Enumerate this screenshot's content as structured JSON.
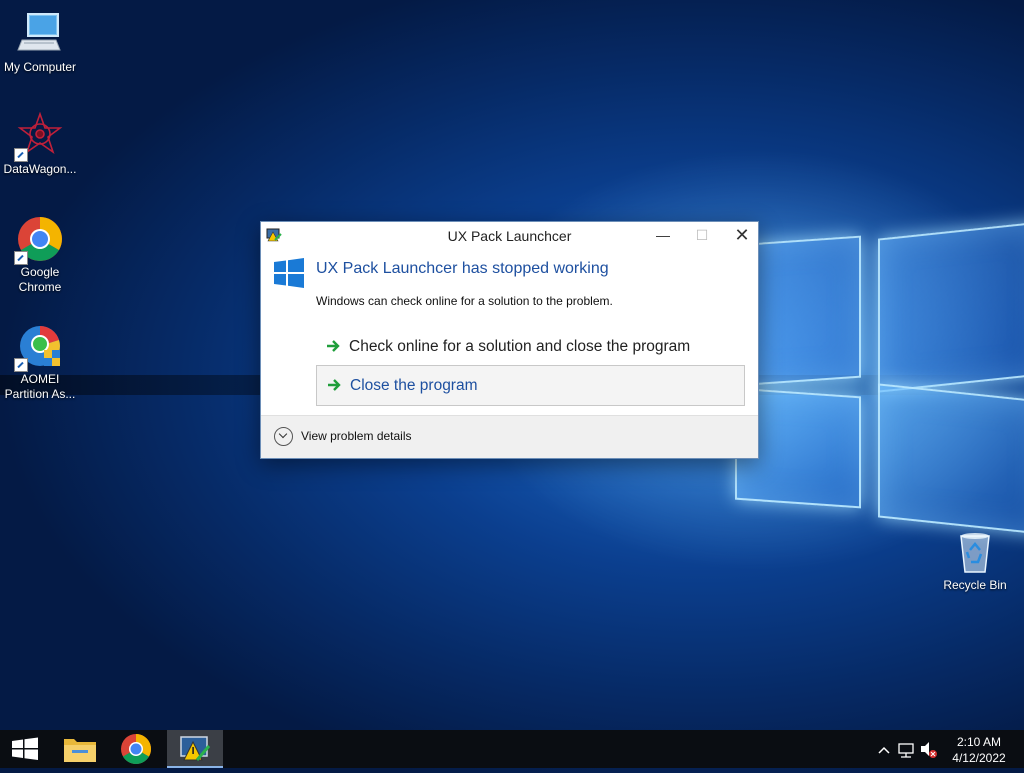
{
  "desktop": {
    "icons": [
      {
        "label_line1": "My Computer",
        "label_line2": ""
      },
      {
        "label_line1": "DataWagon...",
        "label_line2": ""
      },
      {
        "label_line1": "Google",
        "label_line2": "Chrome"
      },
      {
        "label_line1": "AOMEI",
        "label_line2": "Partition As..."
      },
      {
        "label_line1": "Recycle Bin",
        "label_line2": ""
      }
    ]
  },
  "dialog": {
    "title": "UX Pack Launchcer",
    "heading": "UX Pack Launchcer has stopped working",
    "subtext": "Windows can check online for a solution to the problem.",
    "option_check_online": "Check online for a solution and close the program",
    "option_close": "Close the program",
    "details_link": "View problem details",
    "accent_color": "#1e50a0"
  },
  "taskbar": {
    "items": [
      "start-button",
      "file-explorer",
      "google-chrome",
      "ux-pack-launcher"
    ],
    "active_item": "ux-pack-launcher",
    "time": "2:10 AM",
    "date": "4/12/2022"
  }
}
